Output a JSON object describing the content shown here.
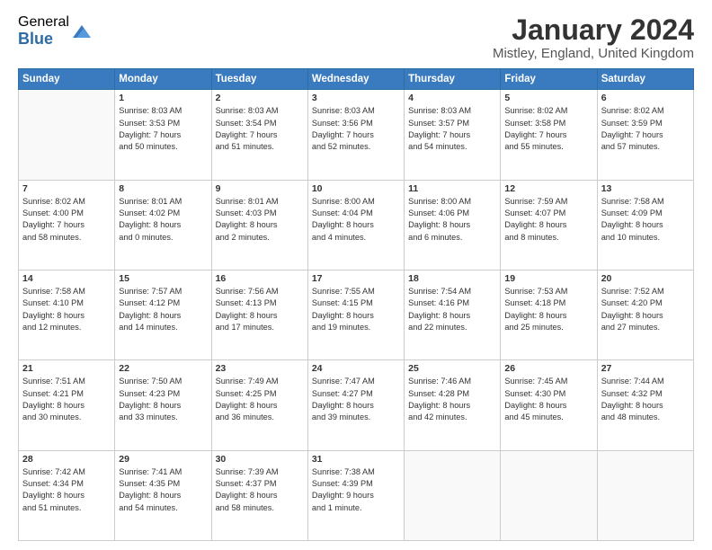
{
  "logo": {
    "general": "General",
    "blue": "Blue"
  },
  "title": "January 2024",
  "location": "Mistley, England, United Kingdom",
  "header_days": [
    "Sunday",
    "Monday",
    "Tuesday",
    "Wednesday",
    "Thursday",
    "Friday",
    "Saturday"
  ],
  "weeks": [
    [
      {
        "day": "",
        "info": ""
      },
      {
        "day": "1",
        "info": "Sunrise: 8:03 AM\nSunset: 3:53 PM\nDaylight: 7 hours\nand 50 minutes."
      },
      {
        "day": "2",
        "info": "Sunrise: 8:03 AM\nSunset: 3:54 PM\nDaylight: 7 hours\nand 51 minutes."
      },
      {
        "day": "3",
        "info": "Sunrise: 8:03 AM\nSunset: 3:56 PM\nDaylight: 7 hours\nand 52 minutes."
      },
      {
        "day": "4",
        "info": "Sunrise: 8:03 AM\nSunset: 3:57 PM\nDaylight: 7 hours\nand 54 minutes."
      },
      {
        "day": "5",
        "info": "Sunrise: 8:02 AM\nSunset: 3:58 PM\nDaylight: 7 hours\nand 55 minutes."
      },
      {
        "day": "6",
        "info": "Sunrise: 8:02 AM\nSunset: 3:59 PM\nDaylight: 7 hours\nand 57 minutes."
      }
    ],
    [
      {
        "day": "7",
        "info": "Sunrise: 8:02 AM\nSunset: 4:00 PM\nDaylight: 7 hours\nand 58 minutes."
      },
      {
        "day": "8",
        "info": "Sunrise: 8:01 AM\nSunset: 4:02 PM\nDaylight: 8 hours\nand 0 minutes."
      },
      {
        "day": "9",
        "info": "Sunrise: 8:01 AM\nSunset: 4:03 PM\nDaylight: 8 hours\nand 2 minutes."
      },
      {
        "day": "10",
        "info": "Sunrise: 8:00 AM\nSunset: 4:04 PM\nDaylight: 8 hours\nand 4 minutes."
      },
      {
        "day": "11",
        "info": "Sunrise: 8:00 AM\nSunset: 4:06 PM\nDaylight: 8 hours\nand 6 minutes."
      },
      {
        "day": "12",
        "info": "Sunrise: 7:59 AM\nSunset: 4:07 PM\nDaylight: 8 hours\nand 8 minutes."
      },
      {
        "day": "13",
        "info": "Sunrise: 7:58 AM\nSunset: 4:09 PM\nDaylight: 8 hours\nand 10 minutes."
      }
    ],
    [
      {
        "day": "14",
        "info": "Sunrise: 7:58 AM\nSunset: 4:10 PM\nDaylight: 8 hours\nand 12 minutes."
      },
      {
        "day": "15",
        "info": "Sunrise: 7:57 AM\nSunset: 4:12 PM\nDaylight: 8 hours\nand 14 minutes."
      },
      {
        "day": "16",
        "info": "Sunrise: 7:56 AM\nSunset: 4:13 PM\nDaylight: 8 hours\nand 17 minutes."
      },
      {
        "day": "17",
        "info": "Sunrise: 7:55 AM\nSunset: 4:15 PM\nDaylight: 8 hours\nand 19 minutes."
      },
      {
        "day": "18",
        "info": "Sunrise: 7:54 AM\nSunset: 4:16 PM\nDaylight: 8 hours\nand 22 minutes."
      },
      {
        "day": "19",
        "info": "Sunrise: 7:53 AM\nSunset: 4:18 PM\nDaylight: 8 hours\nand 25 minutes."
      },
      {
        "day": "20",
        "info": "Sunrise: 7:52 AM\nSunset: 4:20 PM\nDaylight: 8 hours\nand 27 minutes."
      }
    ],
    [
      {
        "day": "21",
        "info": "Sunrise: 7:51 AM\nSunset: 4:21 PM\nDaylight: 8 hours\nand 30 minutes."
      },
      {
        "day": "22",
        "info": "Sunrise: 7:50 AM\nSunset: 4:23 PM\nDaylight: 8 hours\nand 33 minutes."
      },
      {
        "day": "23",
        "info": "Sunrise: 7:49 AM\nSunset: 4:25 PM\nDaylight: 8 hours\nand 36 minutes."
      },
      {
        "day": "24",
        "info": "Sunrise: 7:47 AM\nSunset: 4:27 PM\nDaylight: 8 hours\nand 39 minutes."
      },
      {
        "day": "25",
        "info": "Sunrise: 7:46 AM\nSunset: 4:28 PM\nDaylight: 8 hours\nand 42 minutes."
      },
      {
        "day": "26",
        "info": "Sunrise: 7:45 AM\nSunset: 4:30 PM\nDaylight: 8 hours\nand 45 minutes."
      },
      {
        "day": "27",
        "info": "Sunrise: 7:44 AM\nSunset: 4:32 PM\nDaylight: 8 hours\nand 48 minutes."
      }
    ],
    [
      {
        "day": "28",
        "info": "Sunrise: 7:42 AM\nSunset: 4:34 PM\nDaylight: 8 hours\nand 51 minutes."
      },
      {
        "day": "29",
        "info": "Sunrise: 7:41 AM\nSunset: 4:35 PM\nDaylight: 8 hours\nand 54 minutes."
      },
      {
        "day": "30",
        "info": "Sunrise: 7:39 AM\nSunset: 4:37 PM\nDaylight: 8 hours\nand 58 minutes."
      },
      {
        "day": "31",
        "info": "Sunrise: 7:38 AM\nSunset: 4:39 PM\nDaylight: 9 hours\nand 1 minute."
      },
      {
        "day": "",
        "info": ""
      },
      {
        "day": "",
        "info": ""
      },
      {
        "day": "",
        "info": ""
      }
    ]
  ]
}
